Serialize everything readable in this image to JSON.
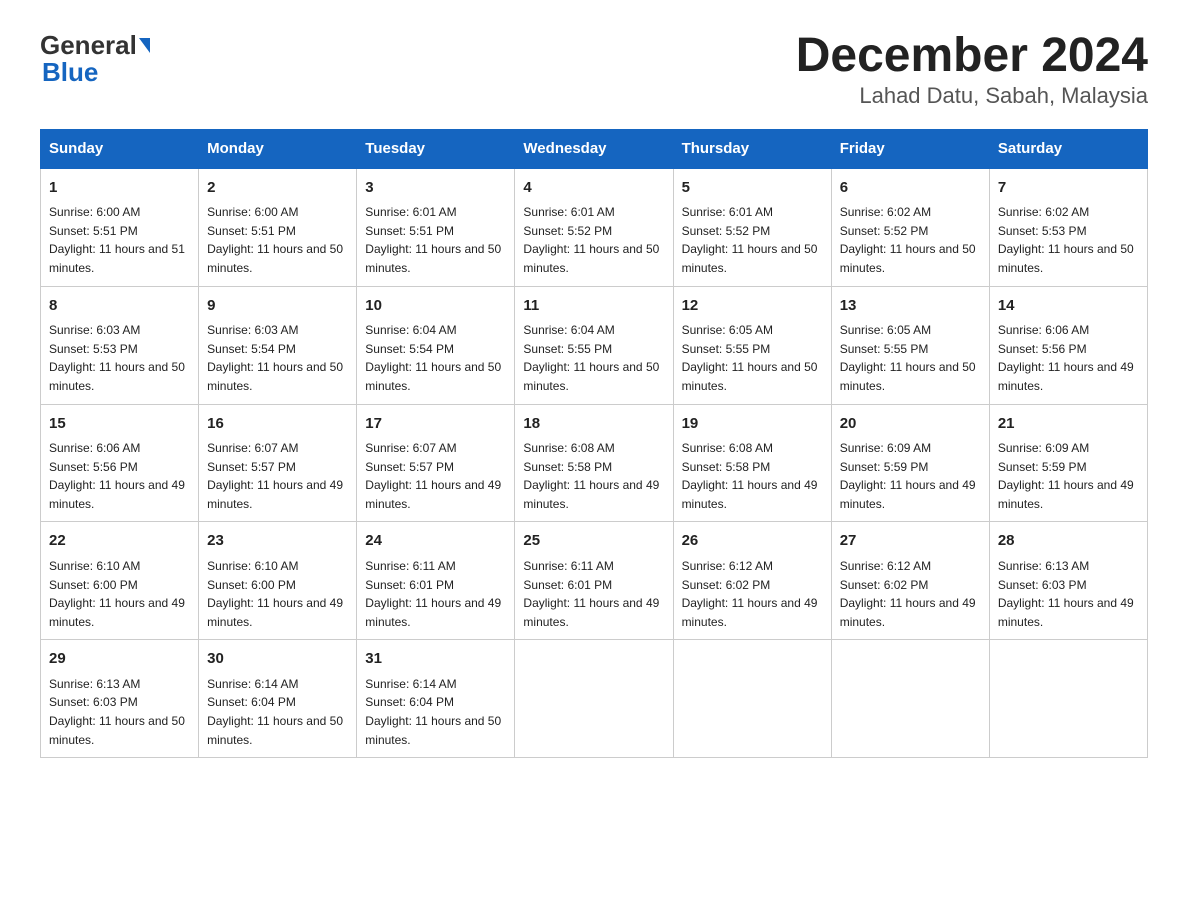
{
  "header": {
    "logo_general": "General",
    "logo_blue": "Blue",
    "title": "December 2024",
    "subtitle": "Lahad Datu, Sabah, Malaysia"
  },
  "columns": [
    "Sunday",
    "Monday",
    "Tuesday",
    "Wednesday",
    "Thursday",
    "Friday",
    "Saturday"
  ],
  "weeks": [
    [
      {
        "day": "1",
        "sunrise": "6:00 AM",
        "sunset": "5:51 PM",
        "daylight": "11 hours and 51 minutes."
      },
      {
        "day": "2",
        "sunrise": "6:00 AM",
        "sunset": "5:51 PM",
        "daylight": "11 hours and 50 minutes."
      },
      {
        "day": "3",
        "sunrise": "6:01 AM",
        "sunset": "5:51 PM",
        "daylight": "11 hours and 50 minutes."
      },
      {
        "day": "4",
        "sunrise": "6:01 AM",
        "sunset": "5:52 PM",
        "daylight": "11 hours and 50 minutes."
      },
      {
        "day": "5",
        "sunrise": "6:01 AM",
        "sunset": "5:52 PM",
        "daylight": "11 hours and 50 minutes."
      },
      {
        "day": "6",
        "sunrise": "6:02 AM",
        "sunset": "5:52 PM",
        "daylight": "11 hours and 50 minutes."
      },
      {
        "day": "7",
        "sunrise": "6:02 AM",
        "sunset": "5:53 PM",
        "daylight": "11 hours and 50 minutes."
      }
    ],
    [
      {
        "day": "8",
        "sunrise": "6:03 AM",
        "sunset": "5:53 PM",
        "daylight": "11 hours and 50 minutes."
      },
      {
        "day": "9",
        "sunrise": "6:03 AM",
        "sunset": "5:54 PM",
        "daylight": "11 hours and 50 minutes."
      },
      {
        "day": "10",
        "sunrise": "6:04 AM",
        "sunset": "5:54 PM",
        "daylight": "11 hours and 50 minutes."
      },
      {
        "day": "11",
        "sunrise": "6:04 AM",
        "sunset": "5:55 PM",
        "daylight": "11 hours and 50 minutes."
      },
      {
        "day": "12",
        "sunrise": "6:05 AM",
        "sunset": "5:55 PM",
        "daylight": "11 hours and 50 minutes."
      },
      {
        "day": "13",
        "sunrise": "6:05 AM",
        "sunset": "5:55 PM",
        "daylight": "11 hours and 50 minutes."
      },
      {
        "day": "14",
        "sunrise": "6:06 AM",
        "sunset": "5:56 PM",
        "daylight": "11 hours and 49 minutes."
      }
    ],
    [
      {
        "day": "15",
        "sunrise": "6:06 AM",
        "sunset": "5:56 PM",
        "daylight": "11 hours and 49 minutes."
      },
      {
        "day": "16",
        "sunrise": "6:07 AM",
        "sunset": "5:57 PM",
        "daylight": "11 hours and 49 minutes."
      },
      {
        "day": "17",
        "sunrise": "6:07 AM",
        "sunset": "5:57 PM",
        "daylight": "11 hours and 49 minutes."
      },
      {
        "day": "18",
        "sunrise": "6:08 AM",
        "sunset": "5:58 PM",
        "daylight": "11 hours and 49 minutes."
      },
      {
        "day": "19",
        "sunrise": "6:08 AM",
        "sunset": "5:58 PM",
        "daylight": "11 hours and 49 minutes."
      },
      {
        "day": "20",
        "sunrise": "6:09 AM",
        "sunset": "5:59 PM",
        "daylight": "11 hours and 49 minutes."
      },
      {
        "day": "21",
        "sunrise": "6:09 AM",
        "sunset": "5:59 PM",
        "daylight": "11 hours and 49 minutes."
      }
    ],
    [
      {
        "day": "22",
        "sunrise": "6:10 AM",
        "sunset": "6:00 PM",
        "daylight": "11 hours and 49 minutes."
      },
      {
        "day": "23",
        "sunrise": "6:10 AM",
        "sunset": "6:00 PM",
        "daylight": "11 hours and 49 minutes."
      },
      {
        "day": "24",
        "sunrise": "6:11 AM",
        "sunset": "6:01 PM",
        "daylight": "11 hours and 49 minutes."
      },
      {
        "day": "25",
        "sunrise": "6:11 AM",
        "sunset": "6:01 PM",
        "daylight": "11 hours and 49 minutes."
      },
      {
        "day": "26",
        "sunrise": "6:12 AM",
        "sunset": "6:02 PM",
        "daylight": "11 hours and 49 minutes."
      },
      {
        "day": "27",
        "sunrise": "6:12 AM",
        "sunset": "6:02 PM",
        "daylight": "11 hours and 49 minutes."
      },
      {
        "day": "28",
        "sunrise": "6:13 AM",
        "sunset": "6:03 PM",
        "daylight": "11 hours and 49 minutes."
      }
    ],
    [
      {
        "day": "29",
        "sunrise": "6:13 AM",
        "sunset": "6:03 PM",
        "daylight": "11 hours and 50 minutes."
      },
      {
        "day": "30",
        "sunrise": "6:14 AM",
        "sunset": "6:04 PM",
        "daylight": "11 hours and 50 minutes."
      },
      {
        "day": "31",
        "sunrise": "6:14 AM",
        "sunset": "6:04 PM",
        "daylight": "11 hours and 50 minutes."
      },
      {
        "day": "",
        "sunrise": "",
        "sunset": "",
        "daylight": ""
      },
      {
        "day": "",
        "sunrise": "",
        "sunset": "",
        "daylight": ""
      },
      {
        "day": "",
        "sunrise": "",
        "sunset": "",
        "daylight": ""
      },
      {
        "day": "",
        "sunrise": "",
        "sunset": "",
        "daylight": ""
      }
    ]
  ]
}
